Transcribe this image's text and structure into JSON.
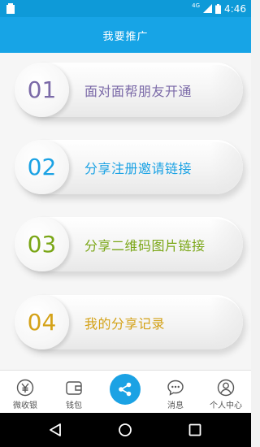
{
  "status_bar": {
    "network": "4G",
    "time": "4:46"
  },
  "header": {
    "title": "我要推广"
  },
  "options": [
    {
      "number": "01",
      "label": "面对面帮朋友开通",
      "color": "#7b6aa8"
    },
    {
      "number": "02",
      "label": "分享注册邀请链接",
      "color": "#1ba2e4"
    },
    {
      "number": "03",
      "label": "分享二维码图片链接",
      "color": "#7aa616"
    },
    {
      "number": "04",
      "label": "我的分享记录",
      "color": "#d4a218"
    }
  ],
  "bottom_nav": {
    "items": [
      {
        "label": "微收银",
        "icon": "yen-icon"
      },
      {
        "label": "钱包",
        "icon": "wallet-icon"
      },
      {
        "label": "",
        "icon": "share-icon"
      },
      {
        "label": "消息",
        "icon": "message-icon"
      },
      {
        "label": "个人中心",
        "icon": "person-icon"
      }
    ]
  },
  "system_nav": {
    "icons": [
      "back-icon",
      "home-icon",
      "recents-icon"
    ]
  },
  "colors": {
    "primary": "#17a4e6",
    "status_bar": "#0e9ad8"
  }
}
